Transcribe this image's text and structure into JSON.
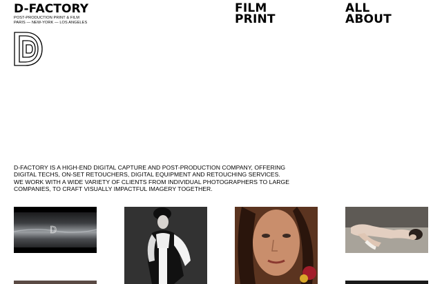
{
  "header": {
    "brand_name": "D-FACTORY",
    "tagline": "POST-PRODUCTION PRINT & FILM",
    "cities": "PARIS — NEW-YORK — LOS ANGELES"
  },
  "nav": {
    "film": "FILM",
    "print": "PRINT",
    "all": "ALL",
    "about": "ABOUT"
  },
  "intro": {
    "line1": "D-FACTORY IS A HIGH-END DIGITAL CAPTURE AND POST-PRODUCTION COMPANY, OFFERING",
    "line2": "DIGITAL TECHS, ON-SET RETOUCHERS, DIGITAL EQUIPMENT AND RETOUCHING SERVICES.",
    "line3": "WE WORK WITH A WIDE VARIETY OF CLIENTS FROM INDIVIDUAL PHOTOGRAPHERS TO LARGE",
    "line4": "COMPANIES, TO CRAFT VISUALLY IMPACTFUL IMAGERY TOGETHER."
  },
  "gallery": {
    "items": [
      {
        "icon": "film-reel-thumbnail"
      },
      {
        "icon": "portrait-photo-thumbnail"
      },
      {
        "icon": "closeup-portrait-thumbnail"
      },
      {
        "icon": "reclining-figure-thumbnail"
      }
    ]
  }
}
